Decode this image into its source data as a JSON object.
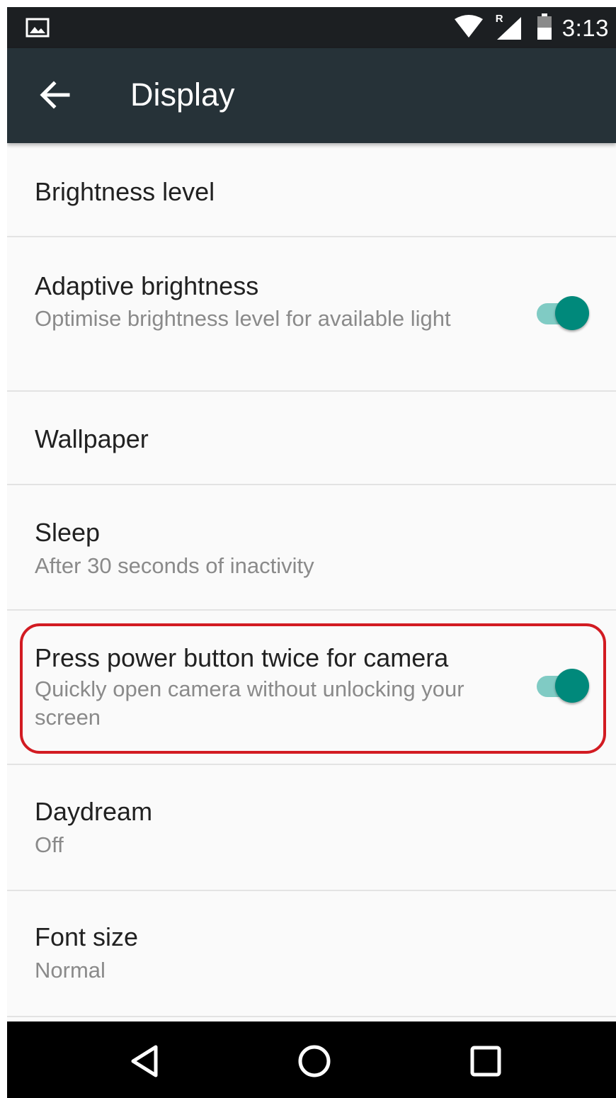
{
  "status_bar": {
    "time": "3:13",
    "icons": [
      "gallery-notification-icon",
      "wifi-icon",
      "roaming-signal-icon",
      "battery-icon"
    ],
    "roaming_label": "R"
  },
  "app_bar": {
    "title": "Display",
    "back_icon": "arrow-back-icon",
    "background": "#263238"
  },
  "settings": [
    {
      "title": "Brightness level"
    },
    {
      "title": "Adaptive brightness",
      "summary": "Optimise brightness level for available light",
      "toggle": true
    },
    {
      "title": "Wallpaper"
    },
    {
      "title": "Sleep",
      "summary": "After 30 seconds of inactivity"
    },
    {
      "title": "Press power button twice for camera",
      "summary": "Quickly open camera without unlocking your screen",
      "toggle": true,
      "highlighted": true
    },
    {
      "title": "Daydream",
      "summary": "Off"
    },
    {
      "title": "Font size",
      "summary": "Normal"
    }
  ],
  "nav_bar": {
    "buttons": [
      "back-triangle-icon",
      "home-circle-icon",
      "recents-square-icon"
    ]
  },
  "colors": {
    "accent": "#00897b",
    "accent_track": "#80cbc4",
    "highlight_border": "#d21b22"
  }
}
